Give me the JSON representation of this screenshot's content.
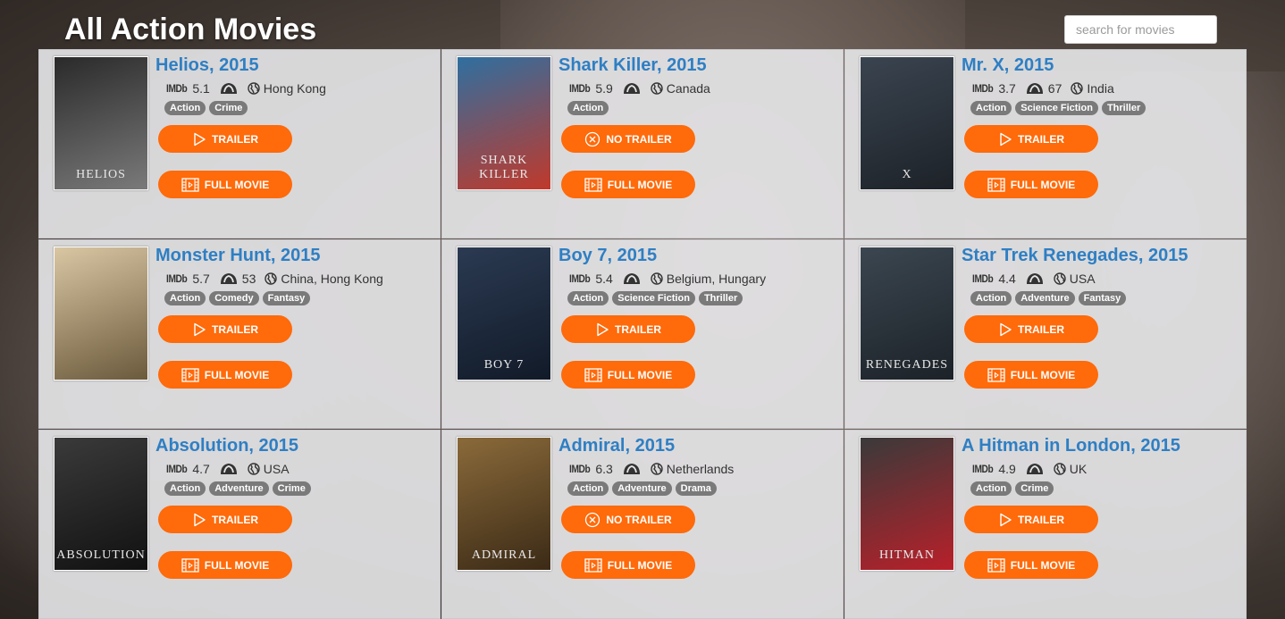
{
  "page": {
    "title": "All Action Movies",
    "search_placeholder": "search for movies"
  },
  "colors": {
    "title_link": "#2e7fc4",
    "button": "#ff6a0a",
    "tag": "#7a7a7a"
  },
  "labels": {
    "imdb": "IMDb",
    "trailer": "TRAILER",
    "no_trailer": "NO TRAILER",
    "full_movie": "FULL MOVIE"
  },
  "movies": [
    {
      "title": "Helios, 2015",
      "imdb": "5.1",
      "rt": "",
      "country": "Hong Kong",
      "tags": [
        "Action",
        "Crime"
      ],
      "trailer": "TRAILER",
      "trailer_icon": "play-icon",
      "poster_text": "HELIOS",
      "poster_colors": [
        "#2a2a2a",
        "#7a7a7a"
      ]
    },
    {
      "title": "Shark Killer, 2015",
      "imdb": "5.9",
      "rt": "",
      "country": "Canada",
      "tags": [
        "Action"
      ],
      "trailer": "NO TRAILER",
      "trailer_icon": "circle-x-icon",
      "poster_text": "SHARK KILLER",
      "poster_colors": [
        "#2f6fa0",
        "#c0392b"
      ]
    },
    {
      "title": "Mr. X, 2015",
      "imdb": "3.7",
      "rt": "67",
      "country": "India",
      "tags": [
        "Action",
        "Science Fiction",
        "Thriller"
      ],
      "trailer": "TRAILER",
      "trailer_icon": "play-icon",
      "poster_text": "X",
      "poster_colors": [
        "#3a4450",
        "#1d2228"
      ]
    },
    {
      "title": "Monster Hunt, 2015",
      "imdb": "5.7",
      "rt": "53",
      "country": "China, Hong Kong",
      "tags": [
        "Action",
        "Comedy",
        "Fantasy"
      ],
      "trailer": "TRAILER",
      "trailer_icon": "play-icon",
      "poster_text": "",
      "poster_colors": [
        "#d9c6a3",
        "#6b5a3c"
      ]
    },
    {
      "title": "Boy 7, 2015",
      "imdb": "5.4",
      "rt": "",
      "country": "Belgium, Hungary",
      "tags": [
        "Action",
        "Science Fiction",
        "Thriller"
      ],
      "trailer": "TRAILER",
      "trailer_icon": "play-icon",
      "poster_text": "BOY 7",
      "poster_colors": [
        "#2b3a52",
        "#111a28"
      ]
    },
    {
      "title": "Star Trek Renegades, 2015",
      "imdb": "4.4",
      "rt": "",
      "country": "USA",
      "tags": [
        "Action",
        "Adventure",
        "Fantasy"
      ],
      "trailer": "TRAILER",
      "trailer_icon": "play-icon",
      "poster_text": "RENEGADES",
      "poster_colors": [
        "#3b4650",
        "#1c2228"
      ]
    },
    {
      "title": "Absolution, 2015",
      "imdb": "4.7",
      "rt": "",
      "country": "USA",
      "tags": [
        "Action",
        "Adventure",
        "Crime"
      ],
      "trailer": "TRAILER",
      "trailer_icon": "play-icon",
      "poster_text": "ABSOLUTION",
      "poster_colors": [
        "#3a3a3a",
        "#111111"
      ]
    },
    {
      "title": "Admiral, 2015",
      "imdb": "6.3",
      "rt": "",
      "country": "Netherlands",
      "tags": [
        "Action",
        "Adventure",
        "Drama"
      ],
      "trailer": "NO TRAILER",
      "trailer_icon": "circle-x-icon",
      "poster_text": "ADMIRAL",
      "poster_colors": [
        "#8a6a3a",
        "#3b2a16"
      ]
    },
    {
      "title": "A Hitman in London, 2015",
      "imdb": "4.9",
      "rt": "",
      "country": "UK",
      "tags": [
        "Action",
        "Crime"
      ],
      "trailer": "TRAILER",
      "trailer_icon": "play-icon",
      "poster_text": "HITMAN",
      "poster_colors": [
        "#3a3a3a",
        "#b8202a"
      ]
    }
  ]
}
